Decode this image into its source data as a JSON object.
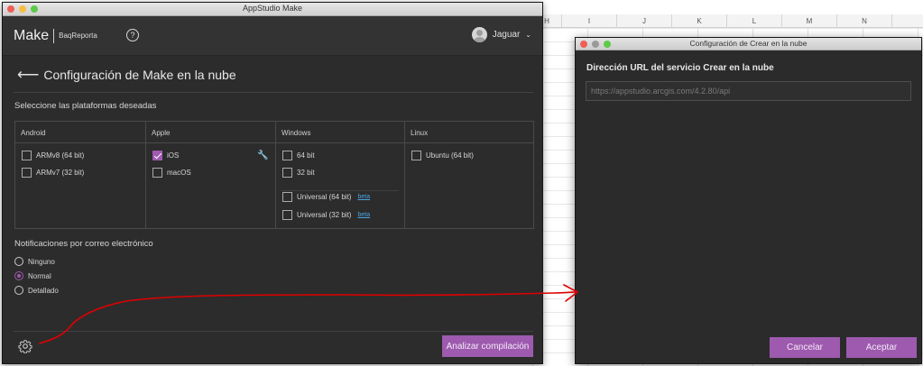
{
  "spreadsheet": {
    "columns": [
      "H",
      "I",
      "J",
      "K",
      "L",
      "M",
      "N"
    ]
  },
  "main_window": {
    "title": "AppStudio Make",
    "brand": "Make",
    "project": "BaqReporta",
    "user": "Jaguar",
    "page_title": "Configuración de Make en la nube",
    "platforms_label": "Seleccione las plataformas deseadas",
    "platforms": {
      "android": {
        "header": "Android",
        "options": [
          {
            "label": "ARMv8 (64 bit)",
            "checked": false
          },
          {
            "label": "ARMv7 (32 bit)",
            "checked": false
          }
        ]
      },
      "apple": {
        "header": "Apple",
        "options": [
          {
            "label": "iOS",
            "checked": true
          },
          {
            "label": "macOS",
            "checked": false
          }
        ]
      },
      "windows": {
        "header": "Windows",
        "options": [
          {
            "label": "64 bit",
            "checked": false
          },
          {
            "label": "32 bit",
            "checked": false
          },
          {
            "label": "Universal (64 bit)",
            "checked": false,
            "badge": "beta"
          },
          {
            "label": "Universal (32 bit)",
            "checked": false,
            "badge": "beta"
          }
        ]
      },
      "linux": {
        "header": "Linux",
        "options": [
          {
            "label": "Ubuntu (64 bit)",
            "checked": false
          }
        ]
      }
    },
    "notifications_label": "Notificaciones por correo electrónico",
    "notifications": [
      {
        "label": "Ninguno",
        "selected": false
      },
      {
        "label": "Normal",
        "selected": true
      },
      {
        "label": "Detallado",
        "selected": false
      }
    ],
    "build_button": "Analizar compilación"
  },
  "dialog": {
    "title": "Configuración de Crear en la nube",
    "url_label": "Dirección URL del servicio Crear en la nube",
    "url_placeholder": "https://appstudio.arcgis.com/4.2.80/api",
    "cancel_button": "Cancelar",
    "accept_button": "Aceptar"
  },
  "colors": {
    "accent": "#9d5aae",
    "window_bg": "#2c2c2c",
    "annotation": "#e00000",
    "link": "#4aa3df"
  }
}
